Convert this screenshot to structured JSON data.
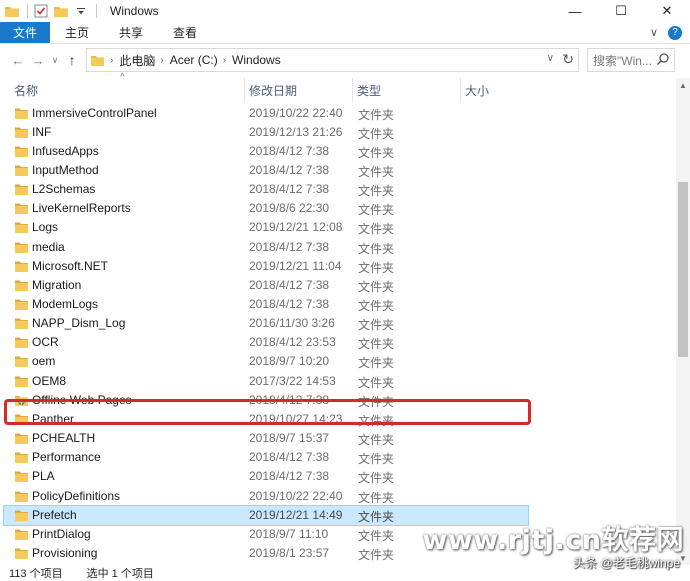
{
  "window": {
    "title": "Windows",
    "minimize": "—",
    "maximize": "☐",
    "close": "✕"
  },
  "ribbon": {
    "tabs": [
      "文件",
      "主页",
      "共享",
      "查看"
    ],
    "collapse": "∨",
    "help": "?"
  },
  "nav": {
    "back": "←",
    "forward": "→",
    "recent": "∨",
    "up": "↑",
    "breadcrumb": [
      "此电脑",
      "Acer (C:)",
      "Windows"
    ],
    "search_placeholder": "搜索\"Win..."
  },
  "columns": {
    "name": "名称",
    "date": "修改日期",
    "type": "类型",
    "size": "大小"
  },
  "files": [
    {
      "name": "ImmersiveControlPanel",
      "date": "2019/10/22 22:40",
      "type": "文件夹",
      "icon": "folder"
    },
    {
      "name": "INF",
      "date": "2019/12/13 21:26",
      "type": "文件夹",
      "icon": "folder"
    },
    {
      "name": "InfusedApps",
      "date": "2018/4/12 7:38",
      "type": "文件夹",
      "icon": "folder"
    },
    {
      "name": "InputMethod",
      "date": "2018/4/12 7:38",
      "type": "文件夹",
      "icon": "folder"
    },
    {
      "name": "L2Schemas",
      "date": "2018/4/12 7:38",
      "type": "文件夹",
      "icon": "folder"
    },
    {
      "name": "LiveKernelReports",
      "date": "2019/8/6 22:30",
      "type": "文件夹",
      "icon": "folder"
    },
    {
      "name": "Logs",
      "date": "2019/12/21 12:08",
      "type": "文件夹",
      "icon": "folder"
    },
    {
      "name": "media",
      "date": "2018/4/12 7:38",
      "type": "文件夹",
      "icon": "folder"
    },
    {
      "name": "Microsoft.NET",
      "date": "2019/12/21 11:04",
      "type": "文件夹",
      "icon": "folder"
    },
    {
      "name": "Migration",
      "date": "2018/4/12 7:38",
      "type": "文件夹",
      "icon": "folder"
    },
    {
      "name": "ModemLogs",
      "date": "2018/4/12 7:38",
      "type": "文件夹",
      "icon": "folder"
    },
    {
      "name": "NAPP_Dism_Log",
      "date": "2016/11/30 3:26",
      "type": "文件夹",
      "icon": "folder"
    },
    {
      "name": "OCR",
      "date": "2018/4/12 23:53",
      "type": "文件夹",
      "icon": "folder"
    },
    {
      "name": "oem",
      "date": "2018/9/7 10:20",
      "type": "文件夹",
      "icon": "folder"
    },
    {
      "name": "OEM8",
      "date": "2017/3/22 14:53",
      "type": "文件夹",
      "icon": "folder"
    },
    {
      "name": "Offline Web Pages",
      "date": "2018/4/12 7:38",
      "type": "文件夹",
      "icon": "web-folder"
    },
    {
      "name": "Panther",
      "date": "2019/10/27 14:23",
      "type": "文件夹",
      "icon": "folder"
    },
    {
      "name": "PCHEALTH",
      "date": "2018/9/7 15:37",
      "type": "文件夹",
      "icon": "folder"
    },
    {
      "name": "Performance",
      "date": "2018/4/12 7:38",
      "type": "文件夹",
      "icon": "folder"
    },
    {
      "name": "PLA",
      "date": "2018/4/12 7:38",
      "type": "文件夹",
      "icon": "folder"
    },
    {
      "name": "PolicyDefinitions",
      "date": "2019/10/22 22:40",
      "type": "文件夹",
      "icon": "folder"
    },
    {
      "name": "Prefetch",
      "date": "2019/12/21 14:49",
      "type": "文件夹",
      "icon": "folder",
      "selected": true
    },
    {
      "name": "PrintDialog",
      "date": "2018/9/7 11:10",
      "type": "文件夹",
      "icon": "folder"
    },
    {
      "name": "Provisioning",
      "date": "2019/8/1 23:57",
      "type": "文件夹",
      "icon": "folder"
    }
  ],
  "status": {
    "count": "113 个项目",
    "selected": "选中 1 个项目"
  },
  "watermark": {
    "site": "www.rjtj.cn软荐网",
    "credit": "头条 @老毛桃winpe"
  },
  "colors": {
    "accent": "#1979ca",
    "folder": "#e8b84a",
    "selection": "#cce8ff",
    "highlight": "#d62a2a"
  }
}
